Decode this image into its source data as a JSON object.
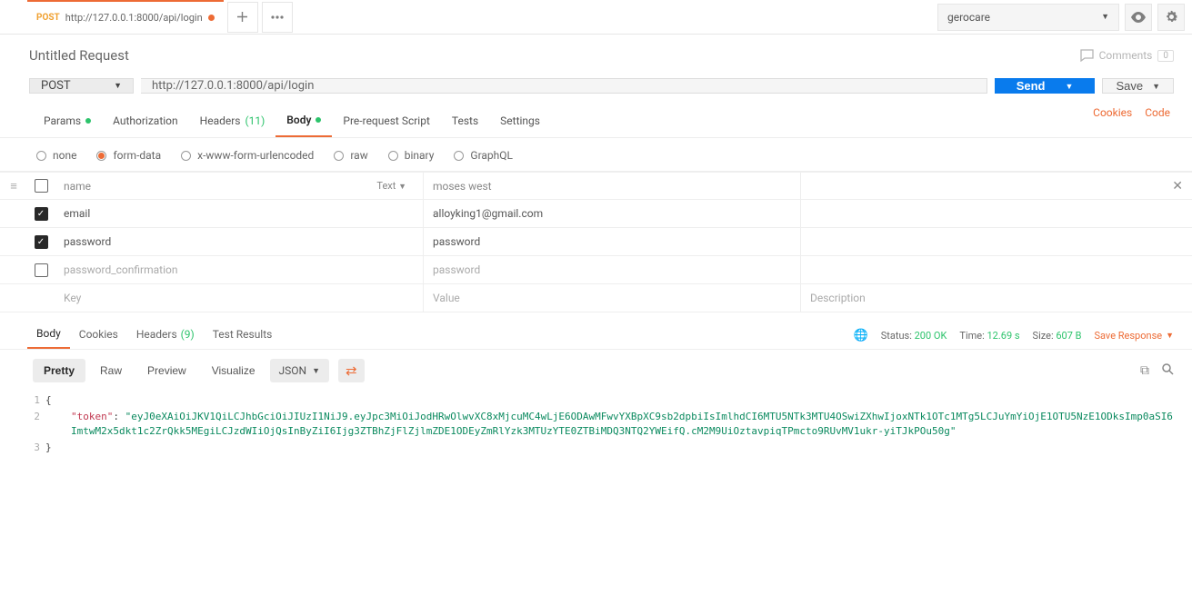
{
  "tab": {
    "method": "POST",
    "url": "http://127.0.0.1:8000/api/login"
  },
  "env": "gerocare",
  "title": "Untitled Request",
  "comments": {
    "label": "Comments",
    "count": "0"
  },
  "request": {
    "method": "POST",
    "url": "http://127.0.0.1:8000/api/login"
  },
  "buttons": {
    "send": "Send",
    "save": "Save"
  },
  "req_tabs": {
    "params": "Params",
    "auth": "Authorization",
    "headers": "Headers",
    "headers_count": "(11)",
    "body": "Body",
    "pre": "Pre-request Script",
    "tests": "Tests",
    "settings": "Settings"
  },
  "links": {
    "cookies": "Cookies",
    "code": "Code"
  },
  "body_types": {
    "none": "none",
    "form": "form-data",
    "xwww": "x-www-form-urlencoded",
    "raw": "raw",
    "binary": "binary",
    "graphql": "GraphQL"
  },
  "form_head": {
    "key": "name",
    "type": "Text",
    "val": "moses west"
  },
  "rows": [
    {
      "key": "email",
      "val": "alloyking1@gmail.com",
      "checked": true
    },
    {
      "key": "password",
      "val": "password",
      "checked": true
    },
    {
      "key": "password_confirmation",
      "val": "password",
      "checked": false
    }
  ],
  "placeholders": {
    "key": "Key",
    "val": "Value",
    "desc": "Description"
  },
  "resp_tabs": {
    "body": "Body",
    "cookies": "Cookies",
    "headers": "Headers",
    "headers_count": "(9)",
    "tests": "Test Results"
  },
  "status": {
    "label": "Status:",
    "value": "200 OK",
    "time_label": "Time:",
    "time": "12.69 s",
    "size_label": "Size:",
    "size": "607 B"
  },
  "save_response": "Save Response",
  "view": {
    "pretty": "Pretty",
    "raw": "Raw",
    "preview": "Preview",
    "visualize": "Visualize",
    "format": "JSON"
  },
  "json": {
    "ln1": "1",
    "ln2": "2",
    "ln3": "3",
    "open": "{",
    "close": "}",
    "token_key": "\"token\"",
    "token_pre": ": ",
    "token_val": "\"eyJ0eXAiOiJKV1QiLCJhbGciOiJIUzI1NiJ9.eyJpc3MiOiJodHRwOlwvXC8xMjcuMC4wLjE6ODAwMFwvYXBpXC9sb2dpbiIsImlhdCI6MTU5NTk3MTU4OSwiZXhwIjoxNTk1OTc1MTg5LCJuYmYiOjE1OTU5NzE1ODksImp0aSI6ImtwM2x5dkt1c2ZrQkk5MEgiLCJzdWIiOjQsInByZiI6Ijg3ZTBhZjFlZjlmZDE1ODEyZmRlYzk3MTUzYTE0ZTBiMDQ3NTQ2YWEifQ.cM2M9UiOztavpiqTPmcto9RUvMV1ukr-yiTJkPOu50g\""
  }
}
